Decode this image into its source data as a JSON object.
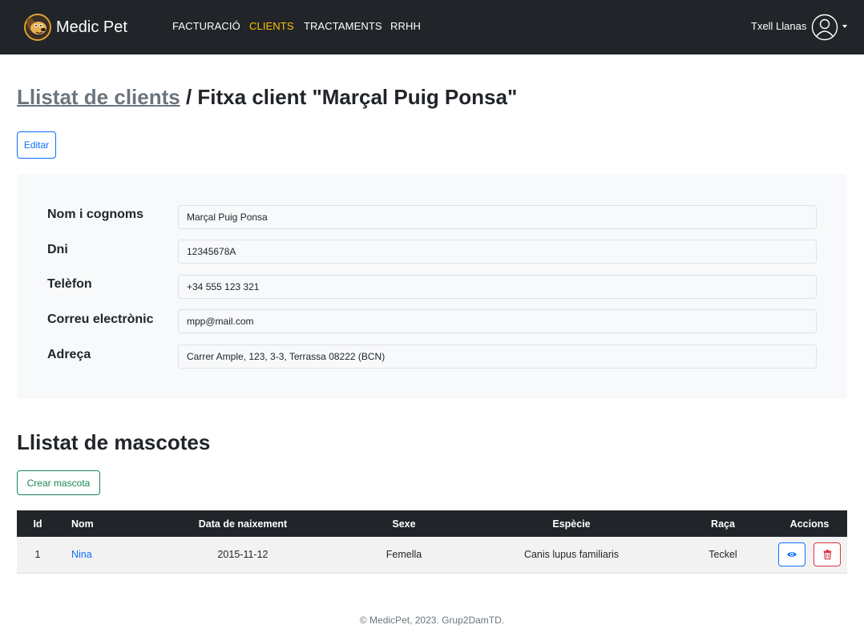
{
  "brand": {
    "name": "Medic Pet"
  },
  "nav": {
    "items": [
      {
        "label": "FACTURACIÓ"
      },
      {
        "label": "CLIENTS"
      },
      {
        "label": "TRACTAMENTS"
      },
      {
        "label": "RRHH"
      }
    ],
    "active": "CLIENTS",
    "user_name": "Txell Llanas"
  },
  "heading": {
    "crumb": "Llistat de clients",
    "separator": " / ",
    "title": "Fitxa client \"Marçal Puig Ponsa\""
  },
  "edit_button": "Editar",
  "client_form": {
    "fields": [
      {
        "label": "Nom i cognoms",
        "value": "Marçal Puig Ponsa"
      },
      {
        "label": "Dni",
        "value": "12345678A"
      },
      {
        "label": "Telèfon",
        "value": "+34 555 123 321"
      },
      {
        "label": "Correu electrònic",
        "value": "mpp@mail.com"
      },
      {
        "label": "Adreça",
        "value": "Carrer Ample, 123, 3-3, Terrassa 08222 (BCN)"
      }
    ]
  },
  "pets": {
    "title": "Llistat de mascotes",
    "create_button": "Crear mascota",
    "columns": [
      "Id",
      "Nom",
      "Data de naixement",
      "Sexe",
      "Espècie",
      "Raça",
      "Accions"
    ],
    "rows": [
      {
        "id": "1",
        "name": "Nina",
        "birth_date": "2015-11-12",
        "sex": "Femella",
        "species": "Canis lupus familiaris",
        "breed": "Teckel"
      }
    ],
    "action_icons": [
      "eye-icon",
      "trash-icon"
    ]
  },
  "footer": "© MedicPet, 2023. Grup2DamTD.",
  "colors": {
    "navbar": "#212529",
    "active_nav": "#ffc107",
    "primary": "#0d6efd",
    "success": "#198754",
    "danger": "#dc3545",
    "muted": "#6c757d",
    "card_bg": "#f8f9fa"
  }
}
